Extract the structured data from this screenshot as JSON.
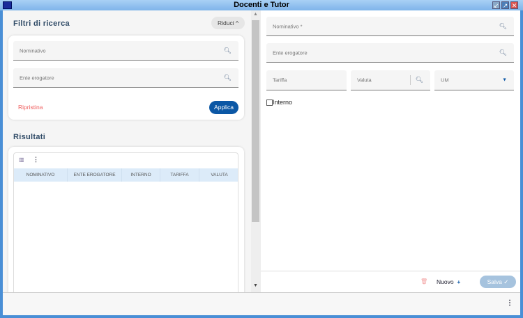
{
  "window": {
    "title": "Docenti e Tutor",
    "buttons": [
      "minimize",
      "maximize",
      "close"
    ]
  },
  "filters": {
    "title": "Filtri di ricerca",
    "collapse_label": "Riduci",
    "fields": [
      {
        "label": "Nominativo"
      },
      {
        "label": "Ente erogatore"
      }
    ],
    "reset_label": "Ripristina",
    "apply_label": "Applica"
  },
  "results": {
    "title": "Risultati",
    "columns": [
      "NOMINATIVO",
      "ENTE EROGATORE",
      "INTERNO",
      "TARIFFA",
      "VALUTA"
    ],
    "rows": []
  },
  "form": {
    "nominativo_label": "Nominativo *",
    "ente_label": "Ente erogatore",
    "tariffa_label": "Tariffa",
    "valuta_label": "Valuta",
    "um_label": "UM",
    "interno_label": "Interno",
    "interno_checked": false
  },
  "footer": {
    "new_label": "Nuovo",
    "save_label": "Salva"
  },
  "colors": {
    "primary": "#0b57a5",
    "danger": "#f06060",
    "save_disabled": "#a6c3de"
  }
}
